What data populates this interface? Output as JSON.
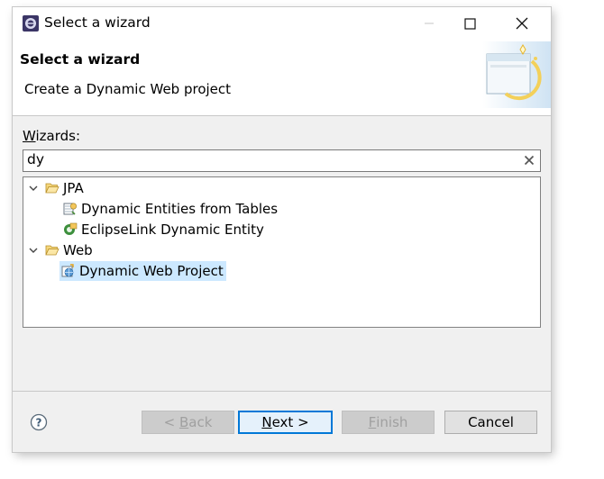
{
  "window": {
    "title": "Select a wizard"
  },
  "header": {
    "title": "Select a wizard",
    "description": "Create a Dynamic Web project"
  },
  "wizards_label": {
    "mnemonic": "W",
    "rest": "izards:"
  },
  "filter": {
    "value": "dy"
  },
  "tree": {
    "groups": [
      {
        "label": "JPA",
        "icon": "folder-open-icon",
        "items": [
          {
            "label": "Dynamic Entities from Tables",
            "icon": "entity-tables-icon"
          },
          {
            "label": "EclipseLink Dynamic Entity",
            "icon": "eclipselink-entity-icon"
          }
        ]
      },
      {
        "label": "Web",
        "icon": "folder-open-icon",
        "items": [
          {
            "label": "Dynamic Web Project",
            "icon": "web-project-icon",
            "selected": true
          }
        ]
      }
    ]
  },
  "buttons": {
    "back": {
      "prefix": "< ",
      "mnemonic": "B",
      "rest": "ack"
    },
    "next": {
      "mnemonic": "N",
      "rest": "ext >"
    },
    "finish": {
      "mnemonic": "F",
      "rest": "inish"
    },
    "cancel": {
      "label": "Cancel"
    }
  },
  "colors": {
    "selection": "#cce8ff",
    "default_button_border": "#0078d7",
    "dialog_bg": "#f0f0f0"
  }
}
